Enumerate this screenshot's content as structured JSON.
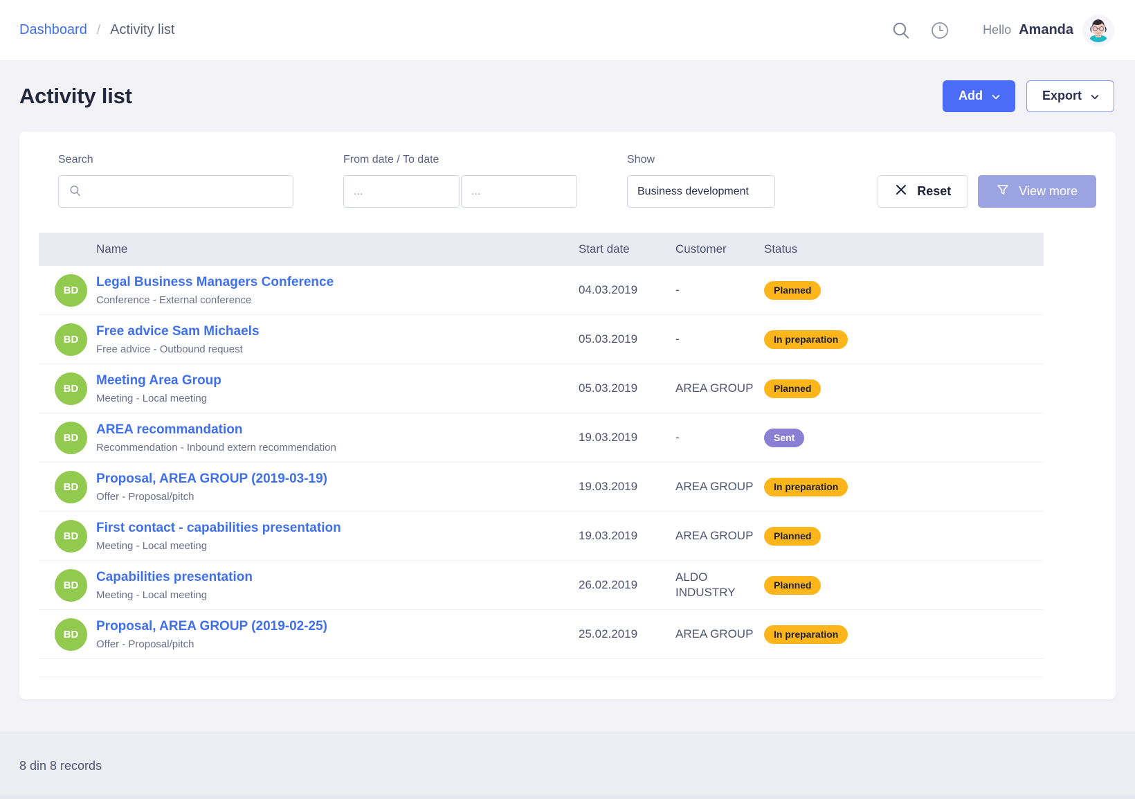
{
  "header": {
    "breadcrumb": {
      "root": "Dashboard",
      "separator": "/",
      "current": "Activity list"
    },
    "search_icon": "search-icon",
    "history_icon": "clock-icon",
    "greeting": "Hello",
    "user_name": "Amanda"
  },
  "page": {
    "title": "Activity list",
    "add_label": "Add",
    "export_label": "Export"
  },
  "filters": {
    "search_label": "Search",
    "search_value": "",
    "search_placeholder": "",
    "date_label": "From date / To date",
    "from_date_value": "",
    "from_date_placeholder": "...",
    "to_date_value": "",
    "to_date_placeholder": "...",
    "show_label": "Show",
    "show_value": "Business development",
    "reset_label": "Reset",
    "view_more_label": "View more"
  },
  "table": {
    "columns": {
      "avatar": "",
      "name": "Name",
      "start_date": "Start date",
      "customer": "Customer",
      "status": "Status"
    },
    "rows": [
      {
        "initials": "BD",
        "name": "Legal Business Managers Conference",
        "subtitle": "Conference - External conference",
        "start_date": "04.03.2019",
        "customer": "-",
        "status": "Planned",
        "status_kind": "planned"
      },
      {
        "initials": "BD",
        "name": "Free advice Sam Michaels",
        "subtitle": "Free advice - Outbound request",
        "start_date": "05.03.2019",
        "customer": "-",
        "status": "In preparation",
        "status_kind": "inprep"
      },
      {
        "initials": "BD",
        "name": "Meeting Area Group",
        "subtitle": "Meeting - Local meeting",
        "start_date": "05.03.2019",
        "customer": "AREA GROUP",
        "status": "Planned",
        "status_kind": "planned"
      },
      {
        "initials": "BD",
        "name": "AREA recommandation",
        "subtitle": "Recommendation - Inbound extern recommendation",
        "start_date": "19.03.2019",
        "customer": "-",
        "status": "Sent",
        "status_kind": "sent"
      },
      {
        "initials": "BD",
        "name": "Proposal, AREA GROUP (2019-03-19)",
        "subtitle": "Offer - Proposal/pitch",
        "start_date": "19.03.2019",
        "customer": "AREA GROUP",
        "status": "In preparation",
        "status_kind": "inprep"
      },
      {
        "initials": "BD",
        "name": "First contact - capabilities presentation",
        "subtitle": "Meeting - Local meeting",
        "start_date": "19.03.2019",
        "customer": "AREA GROUP",
        "status": "Planned",
        "status_kind": "planned"
      },
      {
        "initials": "BD",
        "name": "Capabilities presentation",
        "subtitle": "Meeting - Local meeting",
        "start_date": "26.02.2019",
        "customer": "ALDO INDUSTRY",
        "status": "Planned",
        "status_kind": "planned"
      },
      {
        "initials": "BD",
        "name": "Proposal, AREA GROUP (2019-02-25)",
        "subtitle": "Offer - Proposal/pitch",
        "start_date": "25.02.2019",
        "customer": "AREA GROUP",
        "status": "In preparation",
        "status_kind": "inprep"
      }
    ]
  },
  "footer": {
    "records_text": "8 din 8 records"
  },
  "colors": {
    "primary": "#4a6cf7",
    "link": "#3f6fec",
    "avatar_green": "#92c94f",
    "status_orange": "#fcb61c",
    "status_purple": "#8b7fd4",
    "view_more": "#9ba4e0",
    "page_bg": "#f3f3f7",
    "table_header": "#eaebf2"
  }
}
